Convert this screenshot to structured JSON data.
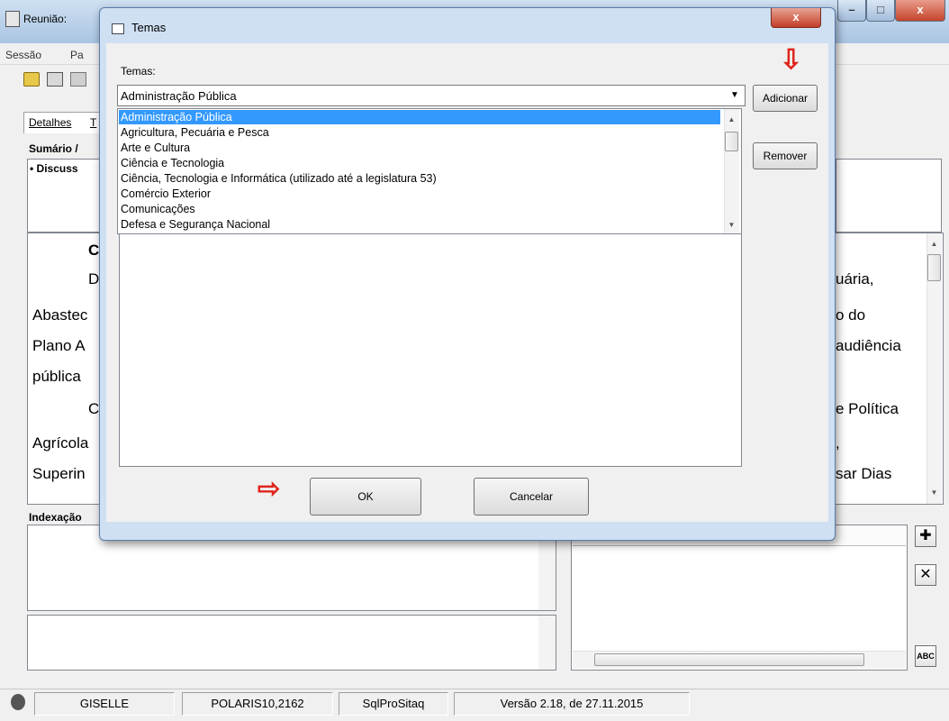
{
  "main_window": {
    "title": "Reunião:",
    "min_glyph": "–",
    "max_glyph": "□",
    "close_glyph": "x"
  },
  "menu": {
    "items": [
      "Sessão",
      "Pa"
    ]
  },
  "toolbar": {
    "icons": [
      "open-folder-icon",
      "print-icon",
      "clipboard-icon"
    ]
  },
  "tabs": {
    "detalhes": "Detalhes",
    "second": "T"
  },
  "sumario": {
    "label": "Sumário /",
    "bullet_text": "• Discuss"
  },
  "document": {
    "left_lines": [
      "C",
      "D",
      "Abastec",
      "Plano A",
      "pública",
      "C",
      "Agrícola",
      "Superin"
    ],
    "right_lines": [
      "uária,",
      "o do",
      "audiência",
      "e Política",
      ",",
      "sar Dias"
    ]
  },
  "indexacao": {
    "label": "Indexação"
  },
  "side_buttons": {
    "add": "✚",
    "delete": "✕",
    "spell": "ABC"
  },
  "statusbar": {
    "user": "GISELLE",
    "server": "POLARIS10,2162",
    "database": "SqlProSitaq",
    "version": "Versão 2.18, de 27.11.2015"
  },
  "dialog": {
    "title": "Temas",
    "close_glyph": "x",
    "temas_label": "Temas:",
    "selected_value": "Administração Pública",
    "add_button": "Adicionar",
    "remove_button": "Remover",
    "ok_button": "OK",
    "cancel_button": "Cancelar",
    "list_items": [
      "Administração Pública",
      "Agricultura, Pecuária e Pesca",
      "Arte e Cultura",
      "Ciência e Tecnologia",
      "Ciência, Tecnologia e Informática (utilizado até a legislatura 53)",
      "Comércio Exterior",
      "Comunicações",
      "Defesa e Segurança Nacional"
    ],
    "selected_index": 0
  },
  "annotations": {
    "arrow_down": "⇩",
    "arrow_right": "⇨"
  },
  "colors": {
    "selection": "#3399ff",
    "annotation_red": "#e0241b",
    "title_bar": "#bcd3ec"
  }
}
